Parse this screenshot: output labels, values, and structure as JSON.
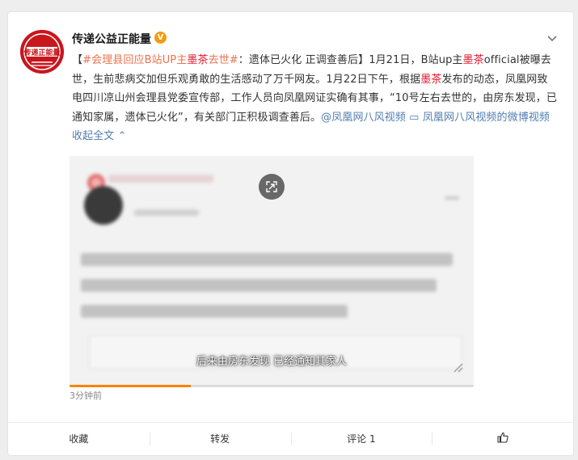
{
  "post": {
    "author": "传递公益正能量",
    "verified_badge": "V",
    "avatar_text": "传递正能量",
    "tag": "#会理县回应B站UP主墨茶去世#",
    "text_parts": [
      {
        "t": "【",
        "c": "plain"
      },
      {
        "t": "#会理县回应B站UP主",
        "c": "tag"
      },
      {
        "t": "墨茶",
        "c": "hl"
      },
      {
        "t": "去世#",
        "c": "tag"
      },
      {
        "t": "：遗体已火化 正调查善后】1月21日，B站up主",
        "c": "plain"
      },
      {
        "t": "墨茶",
        "c": "hl"
      },
      {
        "t": "official被曝去世，生前悲病交加但乐观勇敢的生活感动了万千网友。1月22日下午，根据",
        "c": "plain"
      },
      {
        "t": "墨茶",
        "c": "hl"
      },
      {
        "t": "发布的动态，凤凰网致电四川凉山州会理县党委宣传部，工作人员向凤凰网证实确有其事，“10号左右去世的，由房东发现，已通知家属，遗体已火化”，有关部门正积极调查善后。",
        "c": "plain"
      },
      {
        "t": "@凤凰网八风视频",
        "c": "blue"
      },
      {
        "t": " ▭ ",
        "c": "blue"
      },
      {
        "t": "凤凰网八风视频的微博视频",
        "c": "blue"
      },
      {
        "t": " 收起全文",
        "c": "blue"
      },
      {
        "t": " ⌃",
        "c": "blue"
      }
    ],
    "video_subtitle": "后来由房东发现 已经通知其家人",
    "video_progress": 0.3,
    "time": "3分钟前"
  },
  "actions": {
    "favorite": "收藏",
    "repost": "转发",
    "comment": "评论 1",
    "like": ""
  },
  "colors": {
    "link": "#507daf",
    "tag": "#eb7350",
    "highlight": "#e6162d",
    "accent": "#ff8200"
  }
}
